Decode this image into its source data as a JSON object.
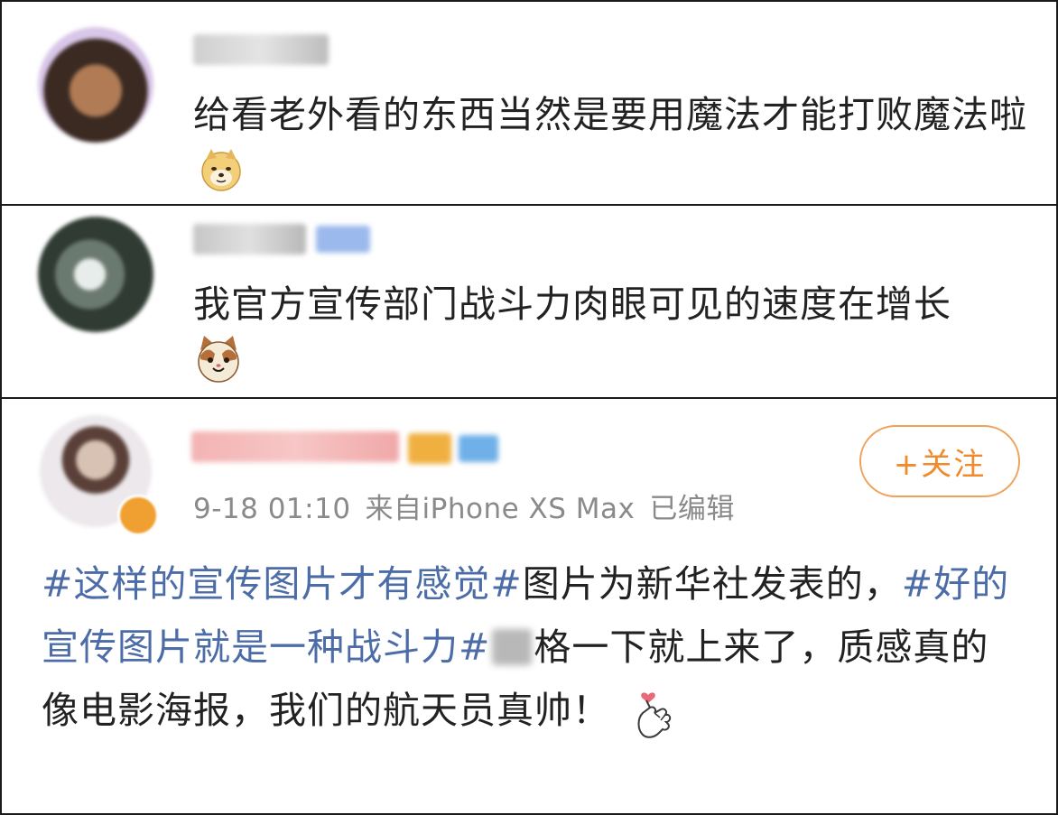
{
  "comments": [
    {
      "text": "给看老外看的东西当然是要用魔法才能打败魔法啦",
      "emoji_icon": "doge-emoji-icon"
    },
    {
      "text": "我官方宣传部门战斗力肉眼可见的速度在增长",
      "emoji_icon": "cat-emoji-icon"
    }
  ],
  "post": {
    "timestamp": "9-18 01:10",
    "source": "来自iPhone XS Max",
    "edited": "已编辑",
    "follow_label": "+关注",
    "hashtag1": "#这样的宣传图片才有感觉#",
    "text1": "图片为新华社发表的，",
    "hashtag2": "#好的宣传图片就是一种战斗力#",
    "text2": "格一下就上来了，质感真的像电影海报，我们的航天员真帅！",
    "emoji_icon": "finger-heart-emoji-icon"
  },
  "colors": {
    "hashtag": "#4c6ca8",
    "follow": "#f08a2c",
    "meta": "#8a8a8a"
  }
}
